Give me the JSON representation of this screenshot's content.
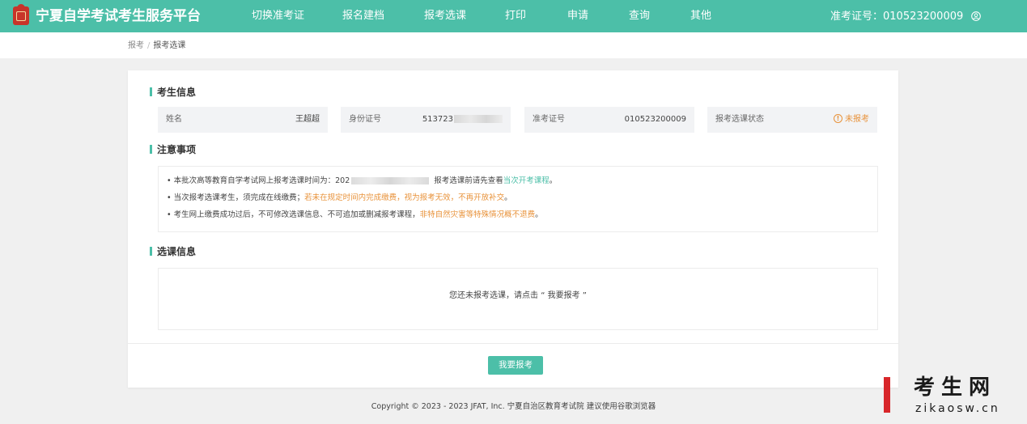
{
  "header": {
    "site_title": "宁夏自学考试考生服务平台",
    "nav": [
      "切换准考证",
      "报名建档",
      "报考选课",
      "打印",
      "申请",
      "查询",
      "其他"
    ],
    "exam_number_label": "准考证号：010523200009",
    "colors": {
      "primary": "#4cbfa8",
      "warning": "#e8923a"
    }
  },
  "breadcrumb": {
    "home": "报考",
    "separator": "/",
    "current": "报考选课"
  },
  "candidate": {
    "section_title": "考生信息",
    "name_label": "姓名",
    "name_value": "王超超",
    "id_label": "身份证号",
    "id_value": "513723",
    "exam_no_label": "准考证号",
    "exam_no_value": "010523200009",
    "status_label": "报考选课状态",
    "status_value": "未报考"
  },
  "notice": {
    "section_title": "注意事项",
    "line1_prefix": "• 本批次高等教育自学考试网上报考选课时间为：202",
    "line1_mid": "报考选课前请先查看",
    "line1_link": "当次开考课程",
    "line1_end": "。",
    "line2_prefix": "• 当次报考选课考生，须完成在线缴费；",
    "line2_highlight": "若未在规定时间内完成缴费，视为报考无效，不再开放补交",
    "line2_end": "。",
    "line3_prefix": "• 考生网上缴费成功过后，不可修改选课信息、不可追加或删减报考课程，",
    "line3_highlight": "非特自然灾害等特殊情况概不退费",
    "line3_end": "。"
  },
  "course": {
    "section_title": "选课信息",
    "empty_message": "您还未报考选课，请点击 “ 我要报考 ”"
  },
  "actions": {
    "apply_label": "我要报考"
  },
  "footer": {
    "text": "Copyright © 2023 - 2023 JFAT, Inc. 宁夏自治区教育考试院 建议使用谷歌浏览器"
  },
  "watermark": {
    "brand_cn": "考生网",
    "brand_en": "zikaosw.cn"
  }
}
